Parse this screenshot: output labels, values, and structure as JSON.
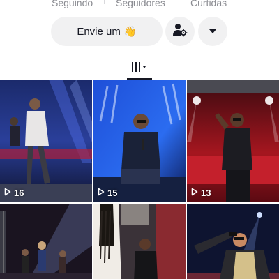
{
  "stats": {
    "following_label": "Seguindo",
    "followers_label": "Seguidores",
    "likes_label": "Curtidas"
  },
  "actions": {
    "message_label": "Envie um 👋",
    "follow_icon": "person-gear-icon",
    "more_icon": "caret-down-icon"
  },
  "tabs": {
    "grid_icon": "video-grid-icon"
  },
  "videos": [
    {
      "views": "16"
    },
    {
      "views": "15"
    },
    {
      "views": "13"
    },
    {
      "views": ""
    },
    {
      "views": ""
    },
    {
      "views": ""
    }
  ],
  "colors": {
    "text_primary": "#161823",
    "text_secondary": "#8a8b91",
    "button_bg": "#f1f1f2"
  }
}
